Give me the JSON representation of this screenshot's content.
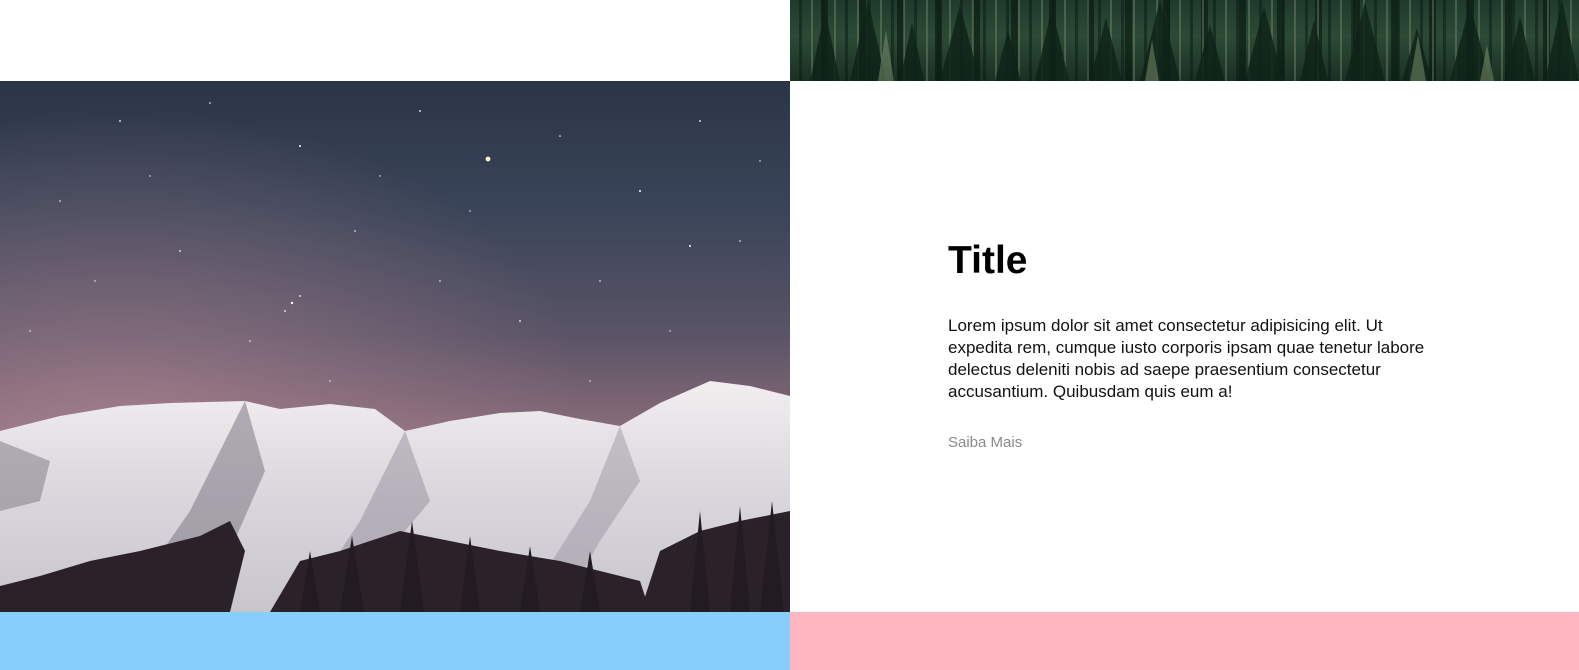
{
  "card": {
    "title": "Title",
    "body": "Lorem ipsum dolor sit amet consectetur adipisicing elit. Ut expedita rem, cumque iusto corporis ipsam quae tenetur labore delectus deleniti nobis ad saepe praesentium consectetur accusantium. Quibusdam quis eum a!",
    "link_label": "Saiba Mais"
  },
  "images": {
    "top_right": "forest-treetops-image",
    "main_left": "snowy-mountains-starry-night-image"
  },
  "colors": {
    "bottom_left_bar": "#87cefa",
    "bottom_right_bar": "#ffb6c1",
    "title_text": "#000000",
    "body_text": "#111111",
    "link_text": "#8a8a8a"
  }
}
